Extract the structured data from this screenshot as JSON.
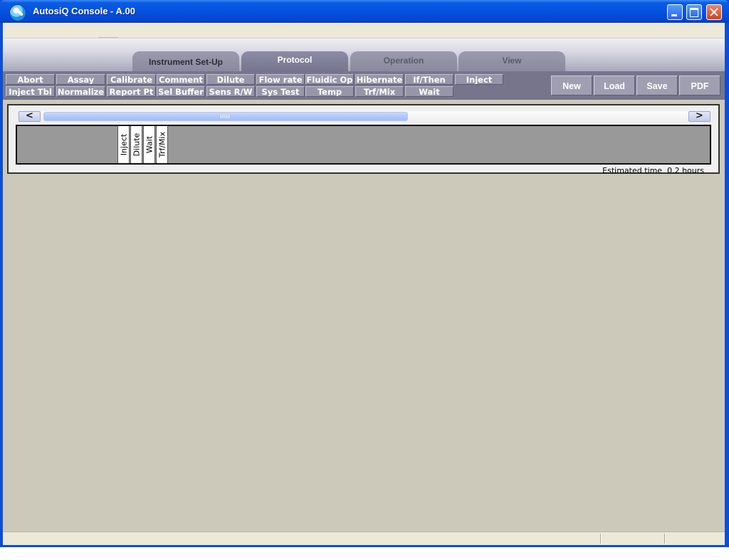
{
  "window": {
    "title": "AutosiQ Console - A.00"
  },
  "tabs": [
    {
      "label": "Instrument Set-Up"
    },
    {
      "label": "Protocol"
    },
    {
      "label": "Operation"
    },
    {
      "label": "View"
    }
  ],
  "commands": {
    "row1": [
      "Abort",
      "Assay",
      "Calibrate",
      "Comment",
      "Dilute",
      "Flow rate",
      "Fluidic Op",
      "Hibernate",
      "If/Then",
      "Inject"
    ],
    "row2": [
      "Inject Tbl",
      "Normalize",
      "Report Pt",
      "Sel Buffer",
      "Sens R/W",
      "Sys Test",
      "Temp",
      "Trf/Mix",
      "Wait"
    ]
  },
  "file_buttons": [
    "New",
    "Load",
    "Save",
    "PDF"
  ],
  "scroll": {
    "left_arrow": "<",
    "right_arrow": ">"
  },
  "protocol_steps": [
    "Inject",
    "Dilute",
    "Wait",
    "Trf/Mix"
  ],
  "estimate": {
    "label": "Estimated time",
    "value": "0.2 hours"
  },
  "colors": {
    "title_bar": "#0552e0",
    "command_bar": "#76758c",
    "command_button": "#9796a9",
    "client_background": "#cdc9ba",
    "timeline_background": "#999999"
  }
}
